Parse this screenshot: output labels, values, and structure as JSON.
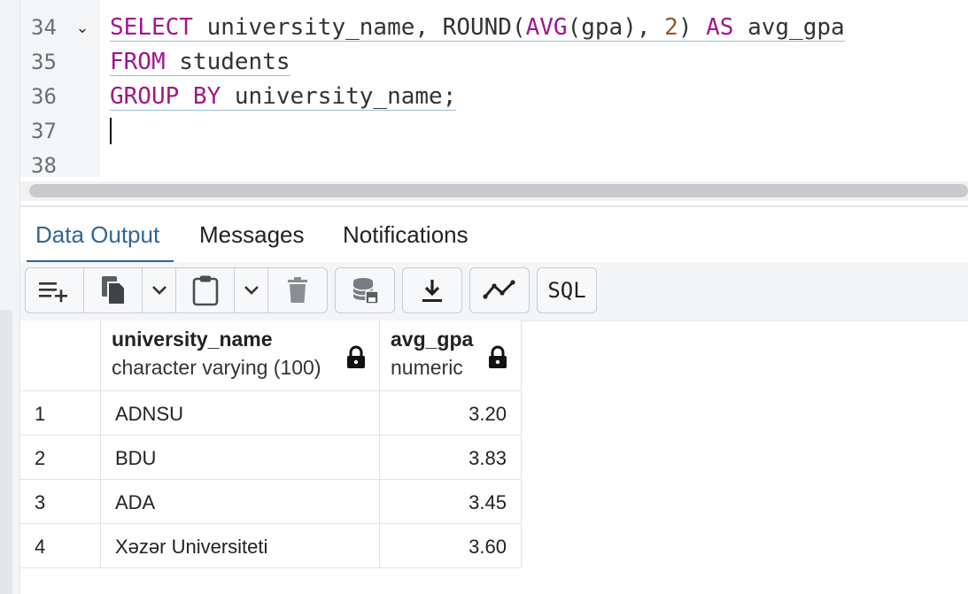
{
  "editor": {
    "lines": [
      {
        "number": "34",
        "fold": "⌄",
        "tokens": [
          {
            "text": "SELECT",
            "cls": "kw"
          },
          {
            "text": " university_name, ROUND(",
            "cls": ""
          },
          {
            "text": "AVG",
            "cls": "kw"
          },
          {
            "text": "(gpa), ",
            "cls": ""
          },
          {
            "text": "2",
            "cls": "num"
          },
          {
            "text": ") ",
            "cls": ""
          },
          {
            "text": "AS",
            "cls": "kw"
          },
          {
            "text": " avg_gpa",
            "cls": ""
          }
        ]
      },
      {
        "number": "35",
        "fold": "",
        "tokens": [
          {
            "text": "FROM",
            "cls": "kw"
          },
          {
            "text": " students",
            "cls": ""
          }
        ]
      },
      {
        "number": "36",
        "fold": "",
        "tokens": [
          {
            "text": "GROUP BY",
            "cls": "kw"
          },
          {
            "text": " university_name;",
            "cls": ""
          }
        ]
      },
      {
        "number": "37",
        "fold": "",
        "tokens": []
      },
      {
        "number": "38",
        "fold": "",
        "tokens": []
      }
    ]
  },
  "tabs": {
    "data_output": "Data Output",
    "messages": "Messages",
    "notifications": "Notifications"
  },
  "toolbar": {
    "sql_label": "SQL"
  },
  "results": {
    "columns": [
      {
        "name": "university_name",
        "type": "character varying (100)"
      },
      {
        "name": "avg_gpa",
        "type": "numeric"
      }
    ],
    "rows": [
      {
        "n": "1",
        "university_name": "ADNSU",
        "avg_gpa": "3.20"
      },
      {
        "n": "2",
        "university_name": "BDU",
        "avg_gpa": "3.83"
      },
      {
        "n": "3",
        "university_name": "ADA",
        "avg_gpa": "3.45"
      },
      {
        "n": "4",
        "university_name": "Xəzər Universiteti",
        "avg_gpa": "3.60"
      }
    ]
  },
  "colors": {
    "keyword": "#a0178d",
    "number": "#8c5a2e",
    "active_tab": "#326690"
  }
}
